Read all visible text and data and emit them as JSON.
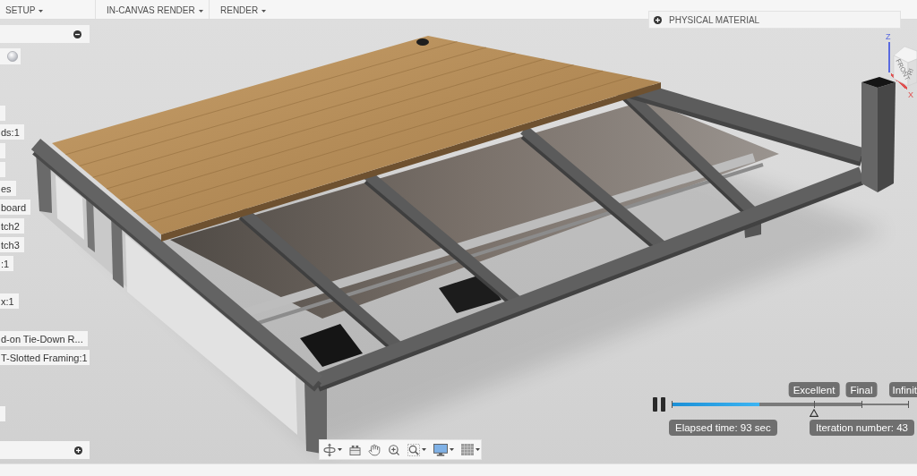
{
  "toolbar": {
    "groups": [
      {
        "label": "SETUP"
      },
      {
        "label": "IN-CANVAS RENDER"
      },
      {
        "label": "RENDER"
      }
    ]
  },
  "material_panel": {
    "title": "PHYSICAL MATERIAL",
    "expanded": false
  },
  "browser": {
    "expanded": true,
    "groups": [
      {
        "items": [
          {
            "kind": "blank"
          },
          {
            "kind": "text",
            "label": "ds:1"
          },
          {
            "kind": "blank"
          },
          {
            "kind": "blank"
          },
          {
            "kind": "text",
            "label": "es"
          },
          {
            "kind": "text",
            "label": "board"
          },
          {
            "kind": "text",
            "label": "tch2"
          },
          {
            "kind": "text",
            "label": "tch3"
          },
          {
            "kind": "text",
            "label": ":1"
          }
        ]
      },
      {
        "items": [
          {
            "kind": "text",
            "label": "x:1"
          }
        ]
      },
      {
        "items": [
          {
            "kind": "text",
            "label": "d-on Tie-Down R..."
          },
          {
            "kind": "text",
            "label": "T-Slotted Framing:1"
          }
        ]
      },
      {
        "items": [
          {
            "kind": "blank"
          }
        ]
      }
    ]
  },
  "comments_panel": {
    "expanded": false
  },
  "view_cube": {
    "faces": [
      "FRONT",
      "RI"
    ],
    "axes": [
      {
        "label": "Z",
        "color": "#5a6ae0"
      },
      {
        "label": "X",
        "color": "#e05050"
      }
    ]
  },
  "render_progress": {
    "running": true,
    "level": 0.37,
    "quality_marks": [
      {
        "label": "Excellent",
        "selected": true
      },
      {
        "label": "Final",
        "selected": false
      },
      {
        "label": "Infinit",
        "selected": false
      }
    ],
    "elapsed": "Elapsed time: 93 sec",
    "iteration": "Iteration number: 43"
  }
}
